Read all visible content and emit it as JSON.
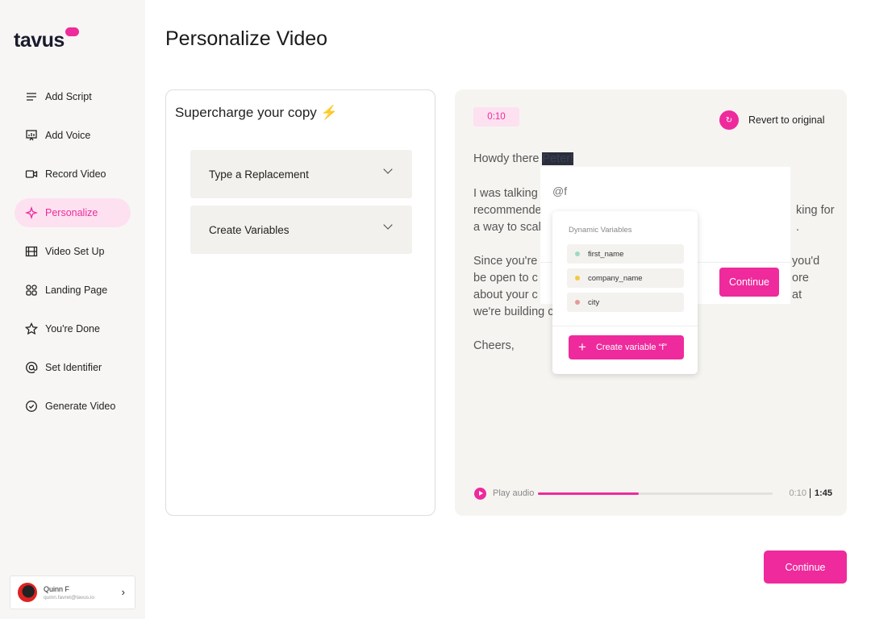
{
  "brand": {
    "logo": "tavus",
    "accent": "#ee2a9c"
  },
  "sidebar": {
    "items": [
      {
        "label": "Add Script",
        "icon": "lines-icon"
      },
      {
        "label": "Add Voice",
        "icon": "presentation-icon"
      },
      {
        "label": "Record Video",
        "icon": "video-camera-icon"
      },
      {
        "label": "Personalize",
        "icon": "sparkle-icon",
        "active": true
      },
      {
        "label": "Video Set Up",
        "icon": "film-icon"
      },
      {
        "label": "Landing Page",
        "icon": "grid-icon"
      },
      {
        "label": "You're Done",
        "icon": "star-icon"
      },
      {
        "label": "Set Identifier",
        "icon": "at-icon"
      },
      {
        "label": "Generate Video",
        "icon": "check-circle-icon"
      }
    ],
    "user": {
      "name": "Quinn F",
      "email": "quinn.favret@tavus.io"
    }
  },
  "header": {
    "title": "Personalize Video"
  },
  "left": {
    "title": "Supercharge your copy",
    "title_icon": "⚡",
    "accordions": [
      "Type a Replacement",
      "Create Variables"
    ]
  },
  "right": {
    "time_badge": "0:10",
    "revert_label": "Revert to original",
    "script": {
      "greeting": "Howdy there ",
      "highlight": "Peter!",
      "l1": "I was talking",
      "l2": "recommende",
      "l2r": "king for",
      "l3": "a way to scal",
      "l3r": ".",
      "l4": "Since you're",
      "l4r": "you'd",
      "l5": "be open to c",
      "l5r": "ore",
      "l6": "about your c",
      "l6r": "at",
      "l7": "we're building c",
      "closing": "Cheers,"
    },
    "editor": {
      "value": "@f",
      "continue_label": "Continue"
    },
    "dropdown": {
      "title": "Dynamic Variables",
      "options": [
        {
          "label": "first_name",
          "color": "#9fd9c6"
        },
        {
          "label": "company_name",
          "color": "#f5c842"
        },
        {
          "label": "city",
          "color": "#e59a9a"
        }
      ],
      "create_label": "Create variable “f”"
    },
    "audio": {
      "label": "Play audio",
      "progress_percent": 43,
      "current": "0:10",
      "total": "1:45"
    }
  },
  "footer": {
    "continue_label": "Continue"
  }
}
